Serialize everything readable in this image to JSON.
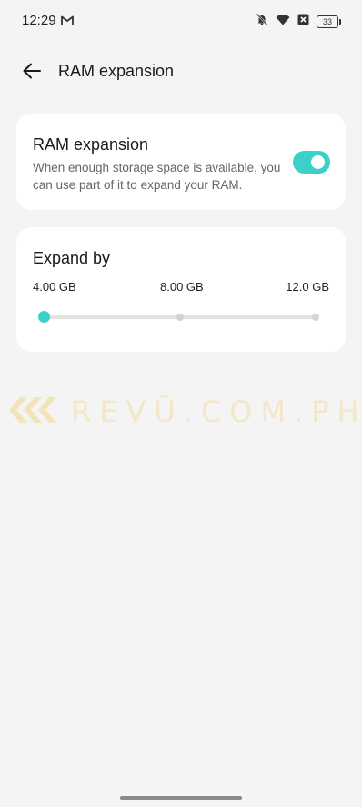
{
  "status_bar": {
    "time": "12:29",
    "battery": "33"
  },
  "header": {
    "title": "RAM expansion"
  },
  "ram_card": {
    "title": "RAM expansion",
    "description": "When enough storage space is available, you can use part of it to expand your RAM.",
    "toggle_on": true
  },
  "expand_card": {
    "title": "Expand by",
    "options": [
      "4.00 GB",
      "8.00 GB",
      "12.0 GB"
    ],
    "selected": "4.00 GB"
  },
  "watermark": {
    "text": "REVŪ.COM.PH"
  },
  "colors": {
    "accent": "#3bd0c8",
    "background": "#f4f4f4",
    "card": "#ffffff"
  }
}
